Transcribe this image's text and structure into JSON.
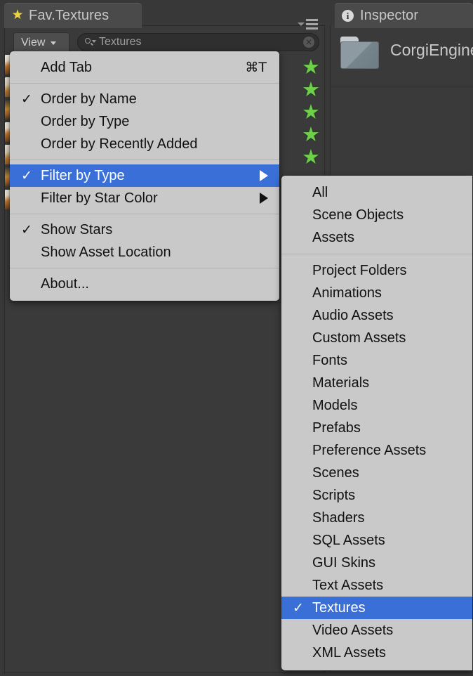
{
  "window": {
    "background_color": "#383838",
    "panel_color": "#3a3a3a",
    "menu_color": "#c9c9c9",
    "highlight_color": "#3a6fd8"
  },
  "fav_panel": {
    "tab_label": "Fav.Textures",
    "tab_icon": "star-icon",
    "panel_menu_icon": "hamburger-menu-icon",
    "toolbar": {
      "view_button_label": "View",
      "search_value": "Textures",
      "search_icon": "search-icon",
      "clear_icon": "clear-icon"
    },
    "star_rows": [
      "green-star",
      "green-star",
      "green-star",
      "green-star",
      "green-star"
    ]
  },
  "inspector": {
    "tab_label": "Inspector",
    "tab_icon": "info-icon",
    "asset_icon": "folder-icon",
    "asset_name": "CorgiEngine"
  },
  "view_menu": {
    "groups": [
      {
        "items": [
          {
            "label": "Add Tab",
            "shortcut": "⌘T",
            "checked": false,
            "submenu": false,
            "selected": false
          }
        ]
      },
      {
        "items": [
          {
            "label": "Order by Name",
            "shortcut": "",
            "checked": true,
            "submenu": false,
            "selected": false
          },
          {
            "label": "Order by Type",
            "shortcut": "",
            "checked": false,
            "submenu": false,
            "selected": false
          },
          {
            "label": "Order by Recently Added",
            "shortcut": "",
            "checked": false,
            "submenu": false,
            "selected": false
          }
        ]
      },
      {
        "items": [
          {
            "label": "Filter by Type",
            "shortcut": "",
            "checked": false,
            "submenu": true,
            "selected": true
          },
          {
            "label": "Filter by Star Color",
            "shortcut": "",
            "checked": false,
            "submenu": true,
            "selected": false
          }
        ]
      },
      {
        "items": [
          {
            "label": "Show Stars",
            "shortcut": "",
            "checked": true,
            "submenu": false,
            "selected": false
          },
          {
            "label": "Show Asset Location",
            "shortcut": "",
            "checked": false,
            "submenu": false,
            "selected": false
          }
        ]
      },
      {
        "items": [
          {
            "label": "About...",
            "shortcut": "",
            "checked": false,
            "submenu": false,
            "selected": false
          }
        ]
      }
    ]
  },
  "filter_by_type_submenu": {
    "groups": [
      {
        "items": [
          {
            "label": "All",
            "checked": false,
            "selected": false
          },
          {
            "label": "Scene Objects",
            "checked": false,
            "selected": false
          },
          {
            "label": "Assets",
            "checked": false,
            "selected": false
          }
        ]
      },
      {
        "items": [
          {
            "label": "Project Folders",
            "checked": false,
            "selected": false
          },
          {
            "label": "Animations",
            "checked": false,
            "selected": false
          },
          {
            "label": "Audio Assets",
            "checked": false,
            "selected": false
          },
          {
            "label": "Custom Assets",
            "checked": false,
            "selected": false
          },
          {
            "label": "Fonts",
            "checked": false,
            "selected": false
          },
          {
            "label": "Materials",
            "checked": false,
            "selected": false
          },
          {
            "label": "Models",
            "checked": false,
            "selected": false
          },
          {
            "label": "Prefabs",
            "checked": false,
            "selected": false
          },
          {
            "label": "Preference Assets",
            "checked": false,
            "selected": false
          },
          {
            "label": "Scenes",
            "checked": false,
            "selected": false
          },
          {
            "label": "Scripts",
            "checked": false,
            "selected": false
          },
          {
            "label": "Shaders",
            "checked": false,
            "selected": false
          },
          {
            "label": "SQL Assets",
            "checked": false,
            "selected": false
          },
          {
            "label": "GUI Skins",
            "checked": false,
            "selected": false
          },
          {
            "label": "Text Assets",
            "checked": false,
            "selected": false
          },
          {
            "label": "Textures",
            "checked": true,
            "selected": true
          },
          {
            "label": "Video Assets",
            "checked": false,
            "selected": false
          },
          {
            "label": "XML Assets",
            "checked": false,
            "selected": false
          }
        ]
      }
    ]
  }
}
